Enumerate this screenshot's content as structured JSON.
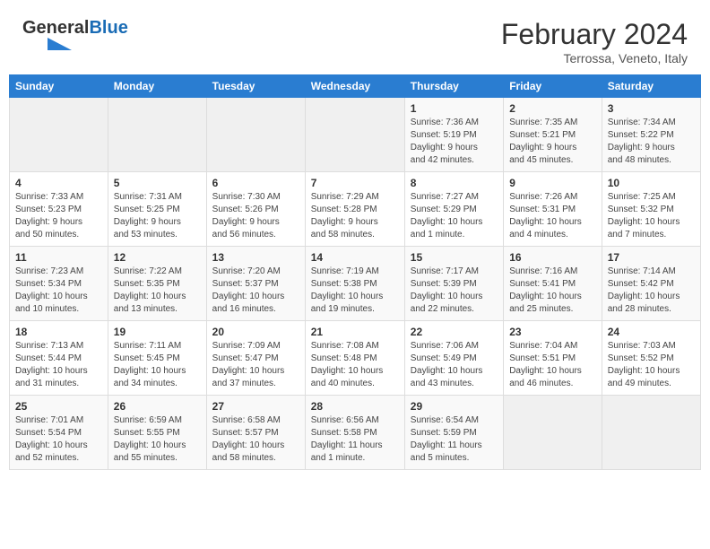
{
  "header": {
    "logo_general": "General",
    "logo_blue": "Blue",
    "title": "February 2024",
    "subtitle": "Terrossa, Veneto, Italy"
  },
  "calendar": {
    "days_of_week": [
      "Sunday",
      "Monday",
      "Tuesday",
      "Wednesday",
      "Thursday",
      "Friday",
      "Saturday"
    ],
    "weeks": [
      [
        {
          "day": "",
          "info": ""
        },
        {
          "day": "",
          "info": ""
        },
        {
          "day": "",
          "info": ""
        },
        {
          "day": "",
          "info": ""
        },
        {
          "day": "1",
          "info": "Sunrise: 7:36 AM\nSunset: 5:19 PM\nDaylight: 9 hours\nand 42 minutes."
        },
        {
          "day": "2",
          "info": "Sunrise: 7:35 AM\nSunset: 5:21 PM\nDaylight: 9 hours\nand 45 minutes."
        },
        {
          "day": "3",
          "info": "Sunrise: 7:34 AM\nSunset: 5:22 PM\nDaylight: 9 hours\nand 48 minutes."
        }
      ],
      [
        {
          "day": "4",
          "info": "Sunrise: 7:33 AM\nSunset: 5:23 PM\nDaylight: 9 hours\nand 50 minutes."
        },
        {
          "day": "5",
          "info": "Sunrise: 7:31 AM\nSunset: 5:25 PM\nDaylight: 9 hours\nand 53 minutes."
        },
        {
          "day": "6",
          "info": "Sunrise: 7:30 AM\nSunset: 5:26 PM\nDaylight: 9 hours\nand 56 minutes."
        },
        {
          "day": "7",
          "info": "Sunrise: 7:29 AM\nSunset: 5:28 PM\nDaylight: 9 hours\nand 58 minutes."
        },
        {
          "day": "8",
          "info": "Sunrise: 7:27 AM\nSunset: 5:29 PM\nDaylight: 10 hours\nand 1 minute."
        },
        {
          "day": "9",
          "info": "Sunrise: 7:26 AM\nSunset: 5:31 PM\nDaylight: 10 hours\nand 4 minutes."
        },
        {
          "day": "10",
          "info": "Sunrise: 7:25 AM\nSunset: 5:32 PM\nDaylight: 10 hours\nand 7 minutes."
        }
      ],
      [
        {
          "day": "11",
          "info": "Sunrise: 7:23 AM\nSunset: 5:34 PM\nDaylight: 10 hours\nand 10 minutes."
        },
        {
          "day": "12",
          "info": "Sunrise: 7:22 AM\nSunset: 5:35 PM\nDaylight: 10 hours\nand 13 minutes."
        },
        {
          "day": "13",
          "info": "Sunrise: 7:20 AM\nSunset: 5:37 PM\nDaylight: 10 hours\nand 16 minutes."
        },
        {
          "day": "14",
          "info": "Sunrise: 7:19 AM\nSunset: 5:38 PM\nDaylight: 10 hours\nand 19 minutes."
        },
        {
          "day": "15",
          "info": "Sunrise: 7:17 AM\nSunset: 5:39 PM\nDaylight: 10 hours\nand 22 minutes."
        },
        {
          "day": "16",
          "info": "Sunrise: 7:16 AM\nSunset: 5:41 PM\nDaylight: 10 hours\nand 25 minutes."
        },
        {
          "day": "17",
          "info": "Sunrise: 7:14 AM\nSunset: 5:42 PM\nDaylight: 10 hours\nand 28 minutes."
        }
      ],
      [
        {
          "day": "18",
          "info": "Sunrise: 7:13 AM\nSunset: 5:44 PM\nDaylight: 10 hours\nand 31 minutes."
        },
        {
          "day": "19",
          "info": "Sunrise: 7:11 AM\nSunset: 5:45 PM\nDaylight: 10 hours\nand 34 minutes."
        },
        {
          "day": "20",
          "info": "Sunrise: 7:09 AM\nSunset: 5:47 PM\nDaylight: 10 hours\nand 37 minutes."
        },
        {
          "day": "21",
          "info": "Sunrise: 7:08 AM\nSunset: 5:48 PM\nDaylight: 10 hours\nand 40 minutes."
        },
        {
          "day": "22",
          "info": "Sunrise: 7:06 AM\nSunset: 5:49 PM\nDaylight: 10 hours\nand 43 minutes."
        },
        {
          "day": "23",
          "info": "Sunrise: 7:04 AM\nSunset: 5:51 PM\nDaylight: 10 hours\nand 46 minutes."
        },
        {
          "day": "24",
          "info": "Sunrise: 7:03 AM\nSunset: 5:52 PM\nDaylight: 10 hours\nand 49 minutes."
        }
      ],
      [
        {
          "day": "25",
          "info": "Sunrise: 7:01 AM\nSunset: 5:54 PM\nDaylight: 10 hours\nand 52 minutes."
        },
        {
          "day": "26",
          "info": "Sunrise: 6:59 AM\nSunset: 5:55 PM\nDaylight: 10 hours\nand 55 minutes."
        },
        {
          "day": "27",
          "info": "Sunrise: 6:58 AM\nSunset: 5:57 PM\nDaylight: 10 hours\nand 58 minutes."
        },
        {
          "day": "28",
          "info": "Sunrise: 6:56 AM\nSunset: 5:58 PM\nDaylight: 11 hours\nand 1 minute."
        },
        {
          "day": "29",
          "info": "Sunrise: 6:54 AM\nSunset: 5:59 PM\nDaylight: 11 hours\nand 5 minutes."
        },
        {
          "day": "",
          "info": ""
        },
        {
          "day": "",
          "info": ""
        }
      ]
    ]
  }
}
